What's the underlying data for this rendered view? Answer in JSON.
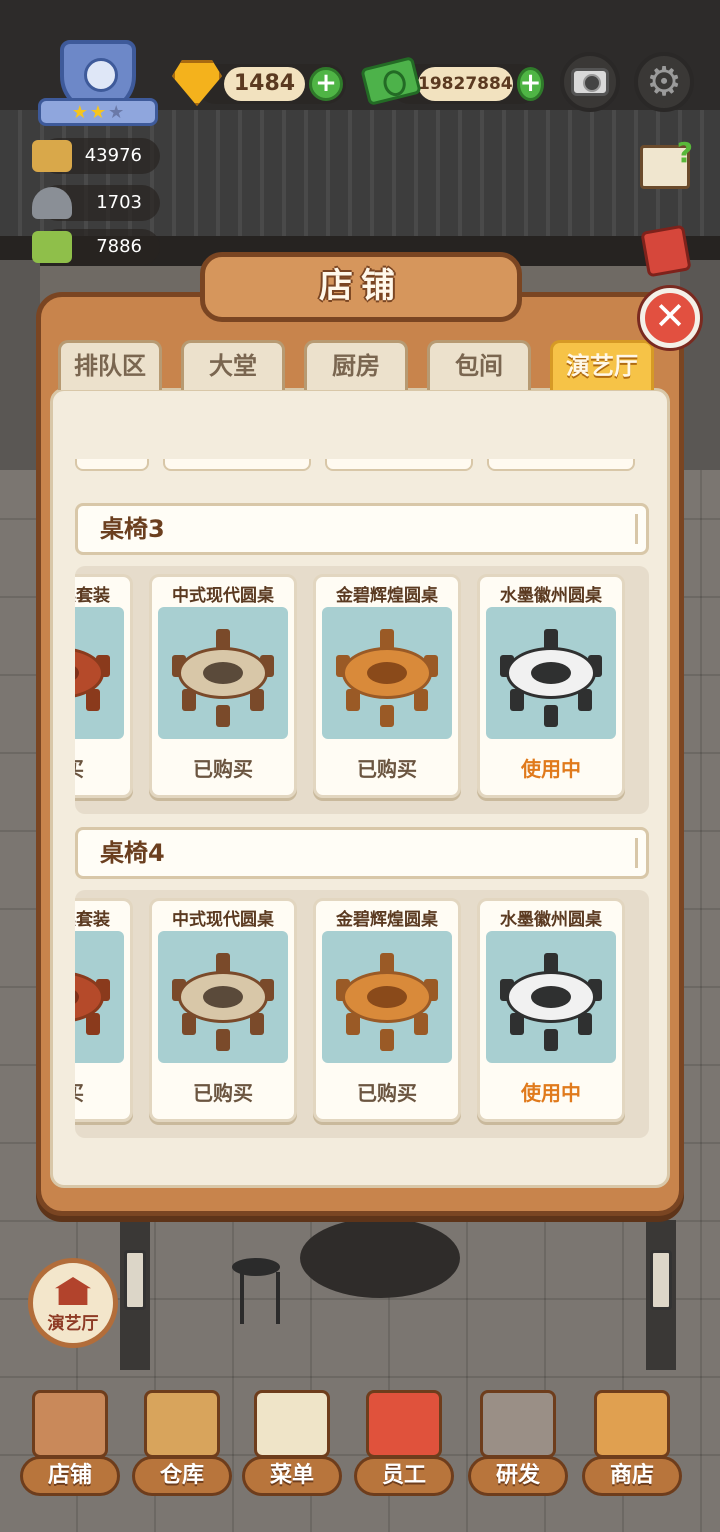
{
  "hud": {
    "stars_filled": 2,
    "stars_total": 3,
    "gems": "1484",
    "cash": "19827884",
    "stats": [
      {
        "name": "dishes",
        "value": "43976"
      },
      {
        "name": "served",
        "value": "1703"
      },
      {
        "name": "menu",
        "value": "7886"
      }
    ]
  },
  "panel": {
    "title": "店铺",
    "close_label": "✕",
    "tabs": [
      {
        "label": "排队区",
        "active": false
      },
      {
        "label": "大堂",
        "active": false
      },
      {
        "label": "厨房",
        "active": false
      },
      {
        "label": "包间",
        "active": false
      },
      {
        "label": "演艺厅",
        "active": true
      }
    ],
    "sections": [
      {
        "header": "桌椅3",
        "items": [
          {
            "name": "桌套装",
            "status": "购买",
            "theme": "red"
          },
          {
            "name": "中式现代圆桌",
            "status": "已购买",
            "theme": "cream"
          },
          {
            "name": "金碧辉煌圆桌",
            "status": "已购买",
            "theme": "gold"
          },
          {
            "name": "水墨徽州圆桌",
            "status": "使用中",
            "theme": "ink"
          }
        ]
      },
      {
        "header": "桌椅4",
        "items": [
          {
            "name": "桌套装",
            "status": "购买",
            "theme": "red"
          },
          {
            "name": "中式现代圆桌",
            "status": "已购买",
            "theme": "cream"
          },
          {
            "name": "金碧辉煌圆桌",
            "status": "已购买",
            "theme": "gold"
          },
          {
            "name": "水墨徽州圆桌",
            "status": "使用中",
            "theme": "ink"
          }
        ]
      }
    ]
  },
  "room_badge": "演艺厅",
  "bottom_nav": [
    {
      "label": "店铺",
      "icon": "shop-building-icon",
      "color": "#c9895a"
    },
    {
      "label": "仓库",
      "icon": "crates-icon",
      "color": "#d8a45c"
    },
    {
      "label": "菜单",
      "icon": "clipboard-icon",
      "color": "#efe4c8"
    },
    {
      "label": "员工",
      "icon": "chef-icon",
      "color": "#e0523c"
    },
    {
      "label": "研发",
      "icon": "wok-icon",
      "color": "#9a8f86"
    },
    {
      "label": "商店",
      "icon": "store-icon",
      "color": "#e0a050"
    }
  ],
  "colors": {
    "using_status": "#e07a1c",
    "tab_active": "#f6c347",
    "panel_wood": "#c8844c"
  }
}
